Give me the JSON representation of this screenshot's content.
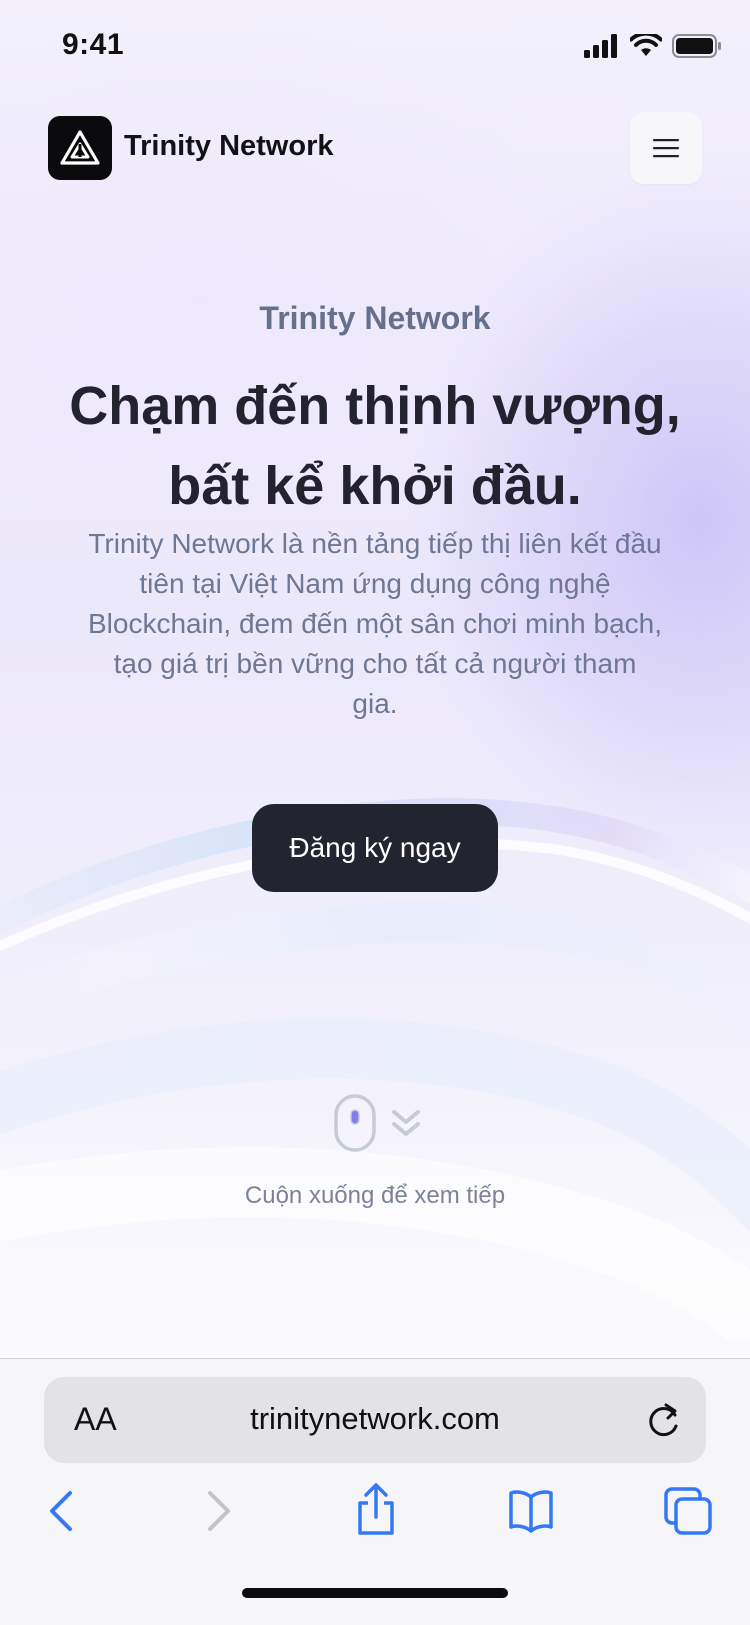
{
  "status_bar": {
    "time": "9:41"
  },
  "header": {
    "brand_name": "Trinity Network"
  },
  "hero": {
    "eyebrow": "Trinity Network",
    "headline_line1": "Chạm đến thịnh vượng,",
    "headline_line2": "bất kể khởi đầu.",
    "description": "Trinity Network là nền tảng tiếp thị liên kết đầu tiên tại Việt Nam ứng dụng công nghệ Blockchain, đem đến một sân chơi minh bạch, tạo giá trị bền vững cho tất cả người tham gia.",
    "cta_label": "Đăng ký ngay",
    "scroll_hint": "Cuộn xuống để xem tiếp"
  },
  "browser": {
    "text_size_label": "AA",
    "url": "trinitynetwork.com"
  },
  "icons": {
    "logo": "triangle-logo-icon",
    "menu": "hamburger-menu-icon",
    "scroll": "mouse-scroll-icon",
    "reload": "reload-icon",
    "back": "chevron-left-icon",
    "forward": "chevron-right-icon",
    "share": "share-icon",
    "bookmarks": "book-icon",
    "tabs": "tabs-icon"
  },
  "colors": {
    "primary_dark": "#22242f",
    "text_muted": "#6e7794",
    "ios_blue": "#3478f6",
    "background_lavender": "#ece8fb"
  }
}
